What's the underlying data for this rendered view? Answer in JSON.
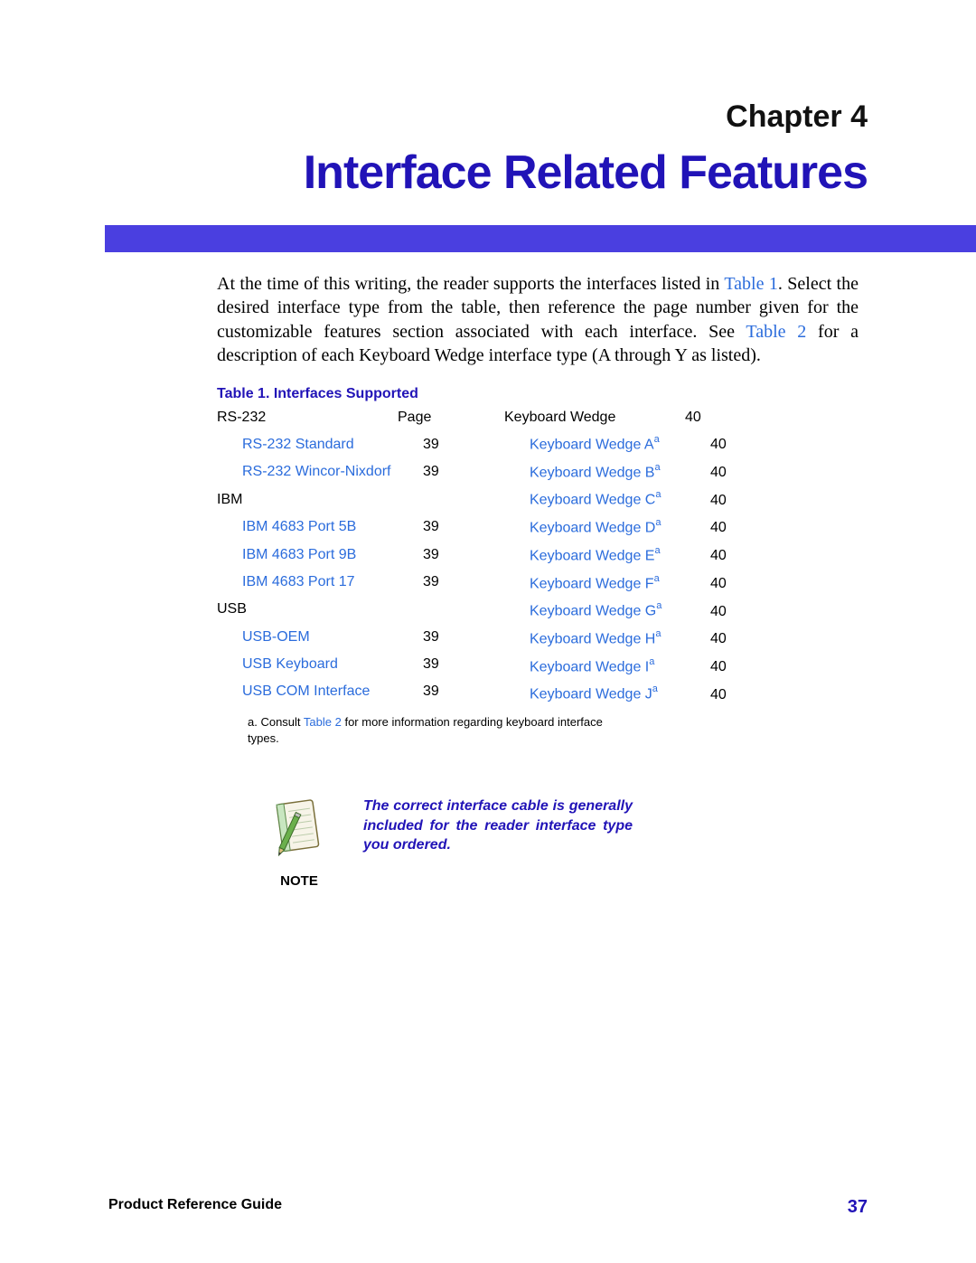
{
  "chapter_label": "Chapter 4",
  "chapter_title": "Interface Related Features",
  "intro_part1": "At the time of this writing, the reader supports the interfaces listed in ",
  "intro_link1": "Table 1",
  "intro_part2": ". Select the desired interface type from the table, then reference the page number given for the customizable features section associated with each interface. See ",
  "intro_link2": "Table 2",
  "intro_part3": " for a description of each Keyboard Wedge interface type (A through Y as listed).",
  "table_caption": "Table 1. Interfaces Supported",
  "left_col": {
    "h1": {
      "name": "RS-232",
      "page": "Page"
    },
    "r1": {
      "name": "RS-232 Standard",
      "page": "39"
    },
    "r2": {
      "name": "RS-232 Wincor-Nixdorf",
      "page": "39"
    },
    "h2": {
      "name": "IBM"
    },
    "r3": {
      "name": "IBM 4683 Port 5B",
      "page": "39"
    },
    "r4": {
      "name": "IBM 4683 Port 9B",
      "page": "39"
    },
    "r5": {
      "name": "IBM 4683 Port 17",
      "page": "39"
    },
    "h3": {
      "name": "USB"
    },
    "r6": {
      "name": "USB-OEM",
      "page": "39"
    },
    "r7": {
      "name": "USB Keyboard",
      "page": "39"
    },
    "r8": {
      "name": "USB COM Interface",
      "page": "39"
    }
  },
  "right_col": {
    "h1": {
      "name": "Keyboard Wedge",
      "page": "40"
    },
    "r1": {
      "name": "Keyboard Wedge A",
      "sup": "a",
      "page": "40"
    },
    "r2": {
      "name": "Keyboard Wedge B",
      "sup": "a",
      "page": "40"
    },
    "r3": {
      "name": "Keyboard Wedge C",
      "sup": "a",
      "page": "40"
    },
    "r4": {
      "name": "Keyboard Wedge D",
      "sup": "a",
      "page": "40"
    },
    "r5": {
      "name": "Keyboard Wedge E",
      "sup": "a",
      "page": "40"
    },
    "r6": {
      "name": "Keyboard Wedge F",
      "sup": "a",
      "page": "40"
    },
    "r7": {
      "name": "Keyboard Wedge G",
      "sup": "a",
      "page": "40"
    },
    "r8": {
      "name": "Keyboard Wedge H",
      "sup": "a",
      "page": "40"
    },
    "r9": {
      "name": "Keyboard Wedge I",
      "sup": "a",
      "page": "40"
    },
    "r10": {
      "name": "Keyboard Wedge J",
      "sup": "a",
      "page": "40"
    }
  },
  "footnote_prefix": "a.  Consult ",
  "footnote_link": "Table 2",
  "footnote_suffix": " for more information regarding keyboard  interface types.",
  "note_label": "NOTE",
  "note_text": "The correct interface cable is generally included for the reader interface type you ordered.",
  "footer_left": "Product Reference Guide",
  "footer_right": "37"
}
